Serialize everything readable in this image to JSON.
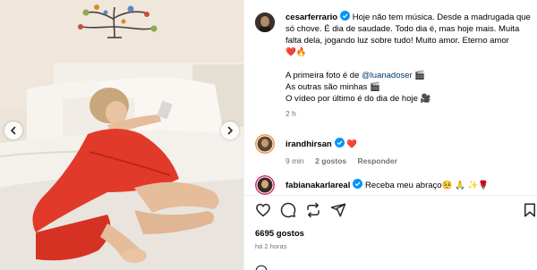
{
  "post": {
    "author": "cesarferrario",
    "caption_lines": [
      "Hoje não tem música. Desde a madrugada que só chove. É dia de saudade. Todo dia é, mas hoje mais. Muita falta dela, jogando luz sobre tudo! Muito amor. Eterno amor"
    ],
    "caption_emoji_1": "❤️",
    "caption_emoji_2": "🔥",
    "photo_credit_prefix": "A primeira foto é de ",
    "photo_credit_mention": "@luanadoser",
    "photo_credit_emoji": "🎬",
    "line_own": "As outras são minhas",
    "line_own_emoji": "🎬",
    "line_video": "O vídeo por último é do dia de hoje",
    "line_video_emoji": "🎥",
    "time_ago": "2 h"
  },
  "comments": [
    {
      "username": "irandhirsan",
      "text": "",
      "emoji": "❤️",
      "time": "9 min",
      "likes": "2 gostos",
      "reply": "Responder"
    },
    {
      "username": "fabianakarlareal",
      "text": "Receba meu abraço",
      "emoji": "🥺 🙏 ✨🌹"
    }
  ],
  "likes": "6695 gostos",
  "posted_time": "há 2 horas",
  "colors": {
    "verified": "#0095f6",
    "mention": "#00376b",
    "muted": "#737373",
    "dress": "#e23a2a"
  },
  "icons": [
    "heart-icon",
    "comment-icon",
    "repost-icon",
    "share-icon",
    "bookmark-icon",
    "verified-icon"
  ]
}
